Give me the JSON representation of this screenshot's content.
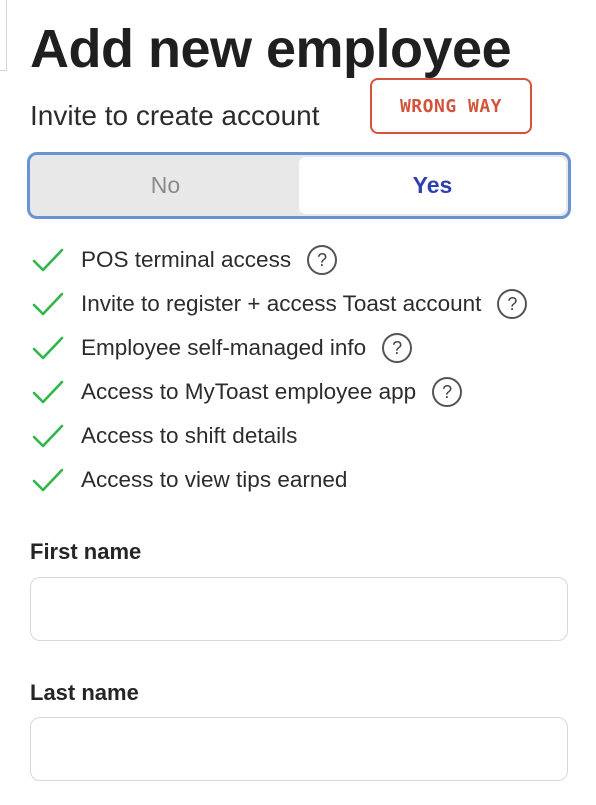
{
  "header": {
    "title": "Add new employee",
    "subtitle": "Invite to create account",
    "stamp": "WRONG WAY"
  },
  "invite_toggle": {
    "options": [
      {
        "label": "No",
        "selected": false
      },
      {
        "label": "Yes",
        "selected": true
      }
    ],
    "accent_color": "#2f3fae",
    "border_color": "#6a93d6"
  },
  "features": {
    "check_color": "#2eb84a",
    "help_icon": "help-circle-icon",
    "help_glyph": "?",
    "items": [
      {
        "label": "POS terminal access",
        "has_help": true
      },
      {
        "label": "Invite to register + access Toast account",
        "has_help": true
      },
      {
        "label": "Employee self-managed info",
        "has_help": true
      },
      {
        "label": "Access to MyToast employee app",
        "has_help": true
      },
      {
        "label": "Access to shift details",
        "has_help": false
      },
      {
        "label": "Access to view tips earned",
        "has_help": false
      }
    ]
  },
  "form": {
    "first_name": {
      "label": "First name",
      "value": "",
      "placeholder": ""
    },
    "last_name": {
      "label": "Last name",
      "value": "",
      "placeholder": ""
    }
  },
  "stamp_color": "#d2543c"
}
